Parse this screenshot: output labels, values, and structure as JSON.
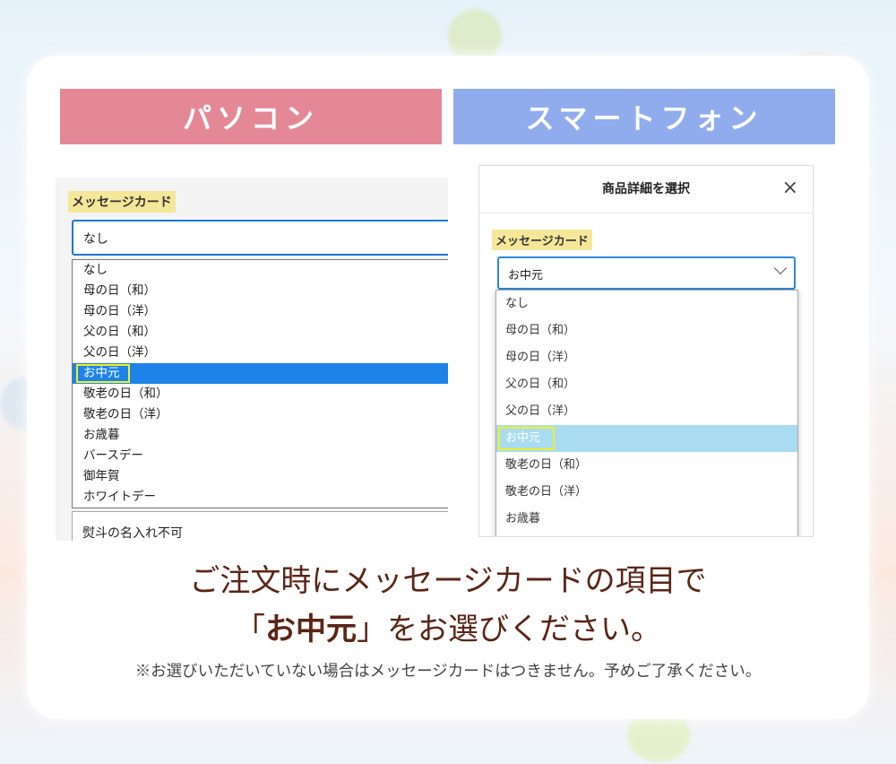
{
  "headers": {
    "pc": "パソコン",
    "smartphone": "スマートフォン"
  },
  "pc": {
    "label": "メッセージカード",
    "selected_value": "なし",
    "options": [
      "なし",
      "母の日（和）",
      "母の日（洋）",
      "父の日（和）",
      "父の日（洋）",
      "お中元",
      "敬老の日（和）",
      "敬老の日（洋）",
      "お歳暮",
      "バースデー",
      "御年賀",
      "ホワイトデー"
    ],
    "highlighted": "お中元",
    "next_field": "熨斗の名入れ不可"
  },
  "smartphone": {
    "title": "商品詳細を選択",
    "close": "×",
    "label": "メッセージカード",
    "selected_value": "お中元",
    "options": [
      "なし",
      "母の日（和）",
      "母の日（洋）",
      "父の日（和）",
      "父の日（洋）",
      "お中元",
      "敬老の日（和）",
      "敬老の日（洋）",
      "お歳暮"
    ],
    "highlighted": "お中元"
  },
  "instructions": {
    "line1": "ご注文時にメッセージカードの項目で",
    "line2_pre": "「",
    "line2_bold": "お中元",
    "line2_post": "」をお選びください。",
    "note": "※お選びいただいていない場合はメッセージカードはつきません。予めご了承ください。"
  },
  "colors": {
    "pc_header": "#e48897",
    "sp_header": "#91aced",
    "text": "#5a2517",
    "highlight": "#f2ef22"
  }
}
